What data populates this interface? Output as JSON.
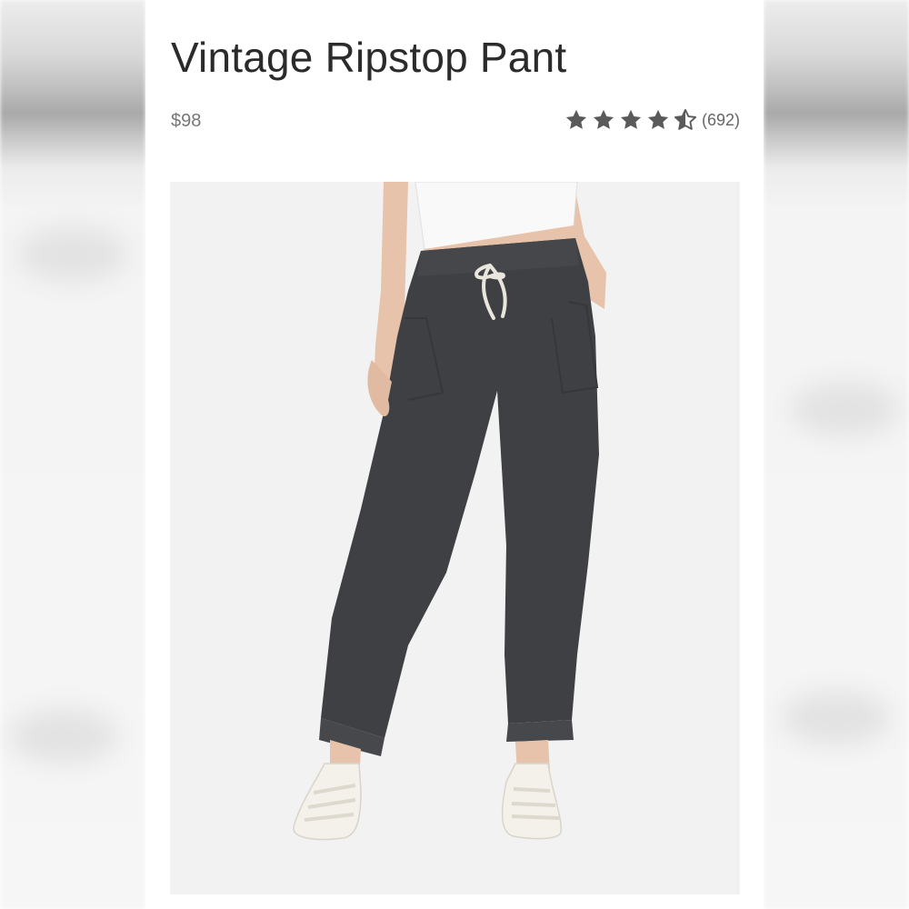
{
  "product": {
    "title": "Vintage Ripstop Pant",
    "price": "$98",
    "rating": {
      "value": 4.5,
      "max": 5,
      "count_label": "(692)"
    }
  },
  "image": {
    "icon": "product-photo",
    "subject": "Vintage Ripstop Pant"
  },
  "colors": {
    "star": "#5a5a5a",
    "pant": "#3f4043",
    "background": "#f2f2f2"
  }
}
